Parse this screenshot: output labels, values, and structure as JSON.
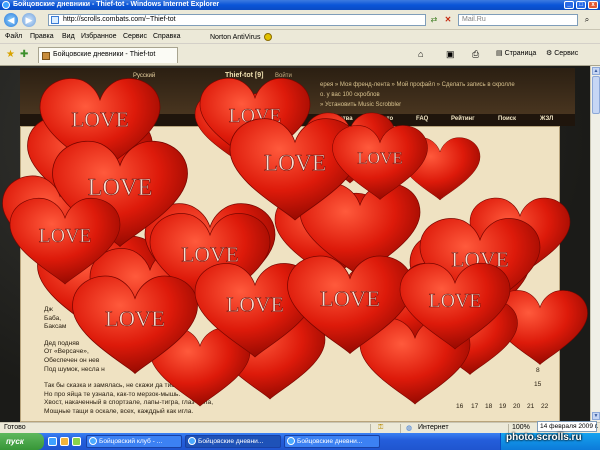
{
  "window": {
    "title": "Бойцовские дневники - Thief-tot - Windows Internet Explorer",
    "minimize": "_",
    "maximize": "□",
    "close": "x"
  },
  "address": {
    "url": "http://scrolls.combats.com/~Thief-tot",
    "search_placeholder": "Mail.Ru"
  },
  "menu": {
    "items": [
      "Файл",
      "Правка",
      "Вид",
      "Избранное",
      "Сервис",
      "Справка"
    ],
    "norton": "Norton AntiVirus"
  },
  "tabs": {
    "active": "Бойцовские дневники - Thief-tot",
    "page_menu": "Страница",
    "tools_menu": "Сервис"
  },
  "site": {
    "lang": "Русский",
    "user": "Thief-tot [9]",
    "login": "Войти",
    "links_1": "ерея » Моя френд-лента » Мой профайл » Сделать запись в скролле",
    "links_2": "о. у вас 100 скроблов",
    "links_3": "» Установить Music Scrobbler",
    "nav": [
      "ообщества",
      "Фото",
      "FAQ",
      "Рейтинг",
      "Поиск",
      "ЖЗЛ"
    ]
  },
  "diary": {
    "lines_a": [
      "Дж",
      "Баба,",
      "Баксам"
    ],
    "lines_b": [
      "Дед подняв",
      "От «Версаче»,",
      "Обеспечен он нев",
      "Под шумок, несла н"
    ],
    "lines_c": [
      "Так бы сказка и замялась, не скажи да тишь.",
      "Но про яйца те узнала, как-то мерзок-мышь.",
      "Хвост, накаченный в спортзале, лапы-тигра, глаз-орла,",
      "Мощные тащи в оскале, всех, кажддый как игла."
    ]
  },
  "calendar": {
    "row_8": [
      "8"
    ],
    "row_15": [
      "15"
    ],
    "row_22": [
      "16",
      "17",
      "18",
      "19",
      "20",
      "21",
      "22"
    ]
  },
  "overlay": {
    "heart_text": "LOVE",
    "heart_color": "#d81c0c"
  },
  "status": {
    "left": "Готово",
    "zone": "Интернет",
    "zoom": "100%"
  },
  "taskbar": {
    "start": "пуск",
    "tasks": [
      "Бойцовский клуб - ...",
      "Бойцовские дневни...",
      "Бойцовские дневни..."
    ],
    "clock": "14 февраля 2009 г."
  },
  "watermark": "photo.scrolls.ru"
}
